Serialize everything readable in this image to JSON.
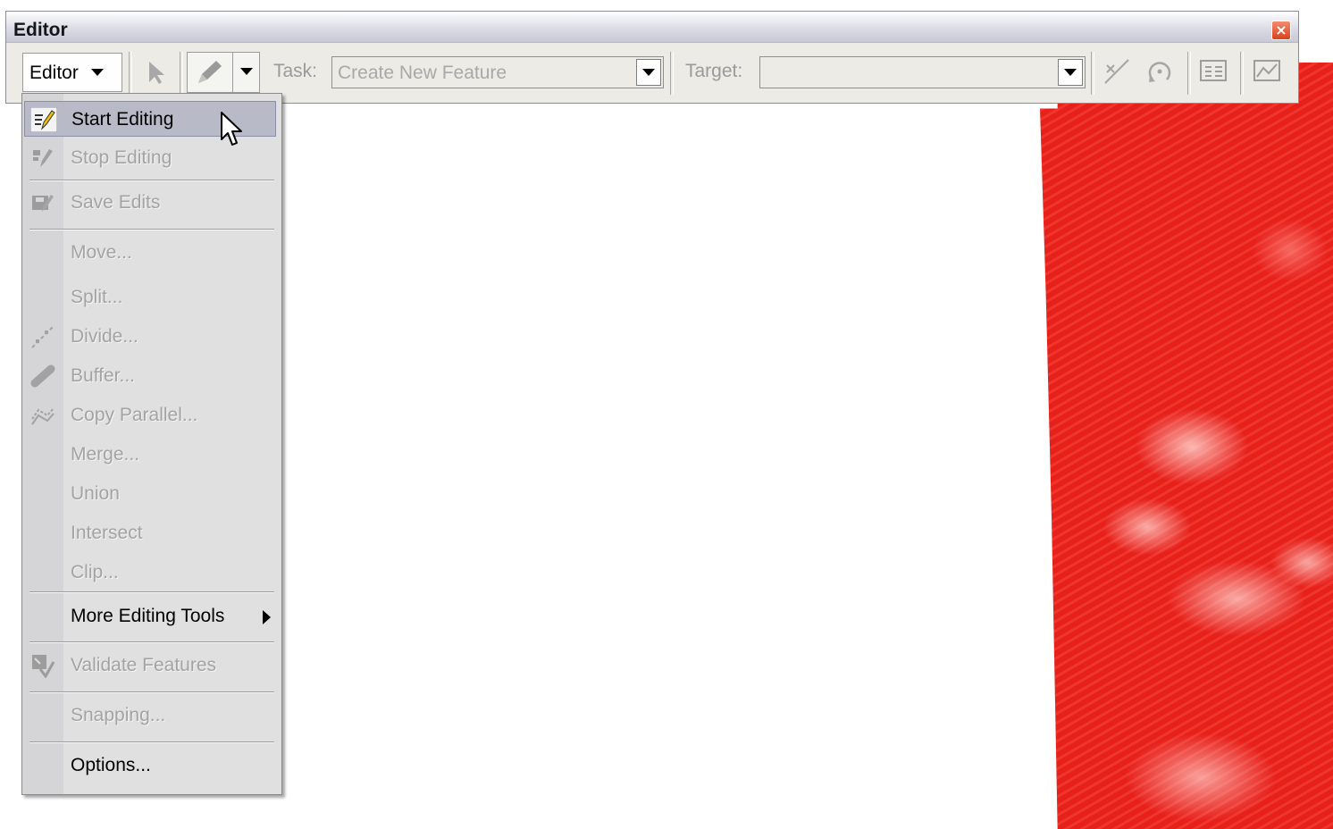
{
  "window": {
    "title": "Editor",
    "close_label": "×"
  },
  "toolbar": {
    "editor_menu_label": "Editor",
    "task_label": "Task:",
    "task_value": "Create New Feature",
    "target_label": "Target:",
    "target_value": ""
  },
  "menu": {
    "items": [
      {
        "label": "Start Editing",
        "enabled": true,
        "icon": "start-editing-icon"
      },
      {
        "label": "Stop Editing",
        "enabled": false,
        "icon": "stop-editing-icon"
      },
      {
        "label": "Save Edits",
        "enabled": false,
        "icon": "save-edits-icon"
      },
      {
        "label": "Move...",
        "enabled": false
      },
      {
        "label": "Split...",
        "enabled": false
      },
      {
        "label": "Divide...",
        "enabled": false,
        "icon": "divide-icon"
      },
      {
        "label": "Buffer...",
        "enabled": false,
        "icon": "buffer-icon"
      },
      {
        "label": "Copy Parallel...",
        "enabled": false,
        "icon": "copy-parallel-icon"
      },
      {
        "label": "Merge...",
        "enabled": false
      },
      {
        "label": "Union",
        "enabled": false
      },
      {
        "label": "Intersect",
        "enabled": false
      },
      {
        "label": "Clip...",
        "enabled": false
      },
      {
        "label": "More Editing Tools",
        "enabled": true,
        "submenu": true
      },
      {
        "label": "Validate Features",
        "enabled": false,
        "icon": "validate-features-icon"
      },
      {
        "label": "Snapping...",
        "enabled": false
      },
      {
        "label": "Options...",
        "enabled": true
      }
    ]
  },
  "colors": {
    "raster_red": "#e8201a",
    "menu_background": "#e0e0e0",
    "menu_highlight": "#b9bac8",
    "disabled_text": "#a3a3a3"
  }
}
